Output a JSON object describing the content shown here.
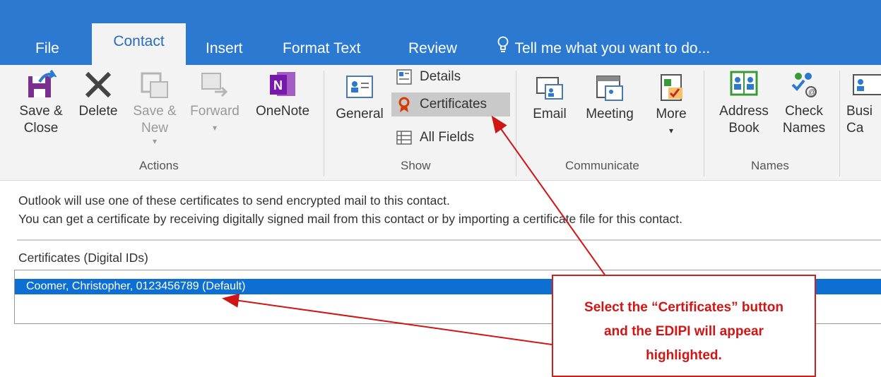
{
  "tabs": [
    {
      "label": "File"
    },
    {
      "label": "Contact"
    },
    {
      "label": "Insert"
    },
    {
      "label": "Format Text"
    },
    {
      "label": "Review"
    }
  ],
  "tell_me": "Tell me what you want to do...",
  "actions": {
    "save_close": "Save & Close",
    "delete": "Delete",
    "save_new": "Save & New",
    "save_new_arrow": "▾",
    "forward": "Forward",
    "forward_arrow": "▾",
    "onenote": "OneNote",
    "group": "Actions"
  },
  "show": {
    "general": "General",
    "details": "Details",
    "certificates": "Certificates",
    "all_fields": "All Fields",
    "group": "Show"
  },
  "communicate": {
    "email": "Email",
    "meeting": "Meeting",
    "more": "More",
    "more_arrow": "▾",
    "group": "Communicate"
  },
  "names": {
    "address_book": "Address Book",
    "check_names": "Check Names",
    "group": "Names"
  },
  "business_card": "Busi Ca",
  "info": {
    "line1": "Outlook will use one of these certificates to send encrypted mail to this contact.",
    "line2": "You can get a certificate by receiving digitally signed mail from this contact or by importing a certificate file for this contact.",
    "certs_label": "Certificates (Digital IDs)"
  },
  "certificates_list": [
    {
      "name": "Coomer, Christopher, 0123456789 (Default)"
    }
  ],
  "callout": {
    "line1": "Select the “Certificates” button",
    "line2": "and the EDIPI will appear",
    "line3": "highlighted."
  },
  "colors": {
    "tabbar": "#2b79d0",
    "selection": "#0e6fd3",
    "callout_red": "#d01515"
  }
}
